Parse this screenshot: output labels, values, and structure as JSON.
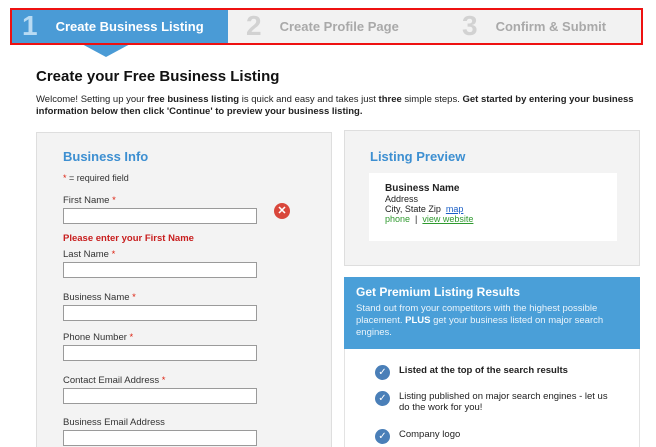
{
  "steps": [
    {
      "number": "1",
      "label": "Create Business Listing"
    },
    {
      "number": "2",
      "label": "Create Profile Page"
    },
    {
      "number": "3",
      "label": "Confirm & Submit"
    }
  ],
  "page": {
    "title": "Create your Free Business Listing",
    "intro_1": "Welcome! Setting up your ",
    "intro_2": "free business listing",
    "intro_3": " is quick and easy and takes just ",
    "intro_4": "three",
    "intro_5": " simple steps. ",
    "intro_6": "Get started by entering your business information below then click 'Continue' to preview your business listing."
  },
  "business_info": {
    "heading": "Business Info",
    "required_star": "*",
    "required_note": " = required field",
    "error_message": "Please enter your First Name",
    "fields": [
      {
        "label": "First Name",
        "required": "*",
        "value": ""
      },
      {
        "label": "Last Name",
        "required": "*",
        "value": ""
      },
      {
        "label": "Business Name",
        "required": "*",
        "value": ""
      },
      {
        "label": "Phone Number",
        "required": "*",
        "value": ""
      },
      {
        "label": "Contact Email Address",
        "required": "*",
        "value": ""
      },
      {
        "label": "Business Email Address",
        "required": "",
        "value": ""
      }
    ]
  },
  "preview": {
    "heading": "Listing Preview",
    "name": "Business Name",
    "address": "Address",
    "city": "City, State Zip",
    "map_link": "map",
    "phone": "phone",
    "separator": "|",
    "website_link": "view website"
  },
  "premium": {
    "heading": "Get Premium Listing Results",
    "text_1": "Stand out from your competitors with the highest possible placement. ",
    "text_2": "PLUS",
    "text_3": " get your business listed on major search engines.",
    "benefits": [
      {
        "text": "Listed at the top of the search results",
        "bold": true
      },
      {
        "text": "Listing published on major search engines - let us do the work for you!",
        "bold": false
      },
      {
        "text": "Company logo",
        "bold": false
      }
    ]
  },
  "colors": {
    "accent": "#4a9bd6",
    "error": "#c81e1e",
    "highlight_outline": "#e11111"
  }
}
